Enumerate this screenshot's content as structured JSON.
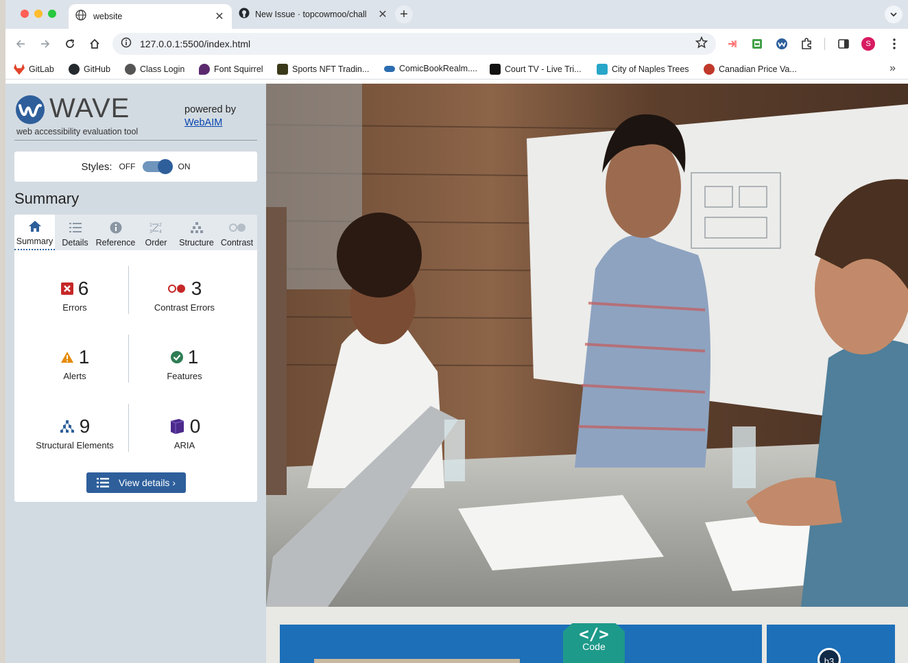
{
  "browser": {
    "tabs": [
      {
        "title": "website",
        "active": true
      },
      {
        "title": "New Issue · topcowmoo/chall",
        "active": false
      }
    ],
    "address": "127.0.0.1:5500/index.html",
    "profile_initial": "S",
    "bookmarks": [
      {
        "label": "GitLab",
        "color": "#e24329"
      },
      {
        "label": "GitHub",
        "color": "#24292e"
      },
      {
        "label": "Class Login",
        "color": "#555555"
      },
      {
        "label": "Font Squirrel",
        "color": "#5b2a6e"
      },
      {
        "label": "Sports NFT Tradin...",
        "color": "#3a3a1a"
      },
      {
        "label": "ComicBookRealm....",
        "color": "#2b6cb0"
      },
      {
        "label": "Court TV - Live Tri...",
        "color": "#111111"
      },
      {
        "label": "City of Naples Trees",
        "color": "#27a6c8"
      },
      {
        "label": "Canadian Price Va...",
        "color": "#c0392b"
      }
    ]
  },
  "wave": {
    "logo_text": "WAVE",
    "logo_sub": "web accessibility evaluation tool",
    "powered_by": "powered by",
    "webaim": "WebAIM",
    "styles_label": "Styles:",
    "off": "OFF",
    "on": "ON",
    "summary_heading": "Summary",
    "tabs": [
      "Summary",
      "Details",
      "Reference",
      "Order",
      "Structure",
      "Contrast"
    ],
    "stats": {
      "errors": {
        "count": "6",
        "label": "Errors"
      },
      "contrast": {
        "count": "3",
        "label": "Contrast Errors"
      },
      "alerts": {
        "count": "1",
        "label": "Alerts"
      },
      "features": {
        "count": "1",
        "label": "Features"
      },
      "structure": {
        "count": "9",
        "label": "Structural Elements"
      },
      "aria": {
        "count": "0",
        "label": "ARIA"
      }
    },
    "view_details": "View details ›"
  },
  "page": {
    "code_label": "Code",
    "code_symbol": "</>",
    "h3_badge": "h3"
  },
  "colors": {
    "wave_blue": "#2e5f9b",
    "error_red": "#c62828",
    "alert_orange": "#e68a00",
    "feature_green": "#2e7d55",
    "aria_purple": "#4b2a8c"
  }
}
